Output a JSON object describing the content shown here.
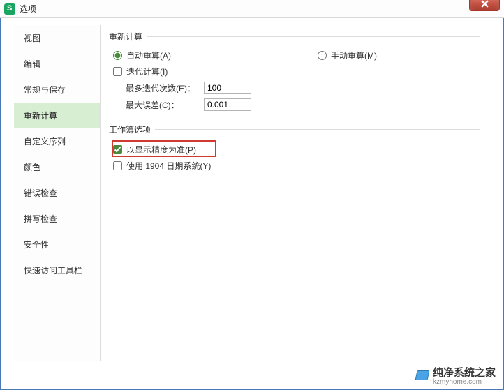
{
  "window": {
    "title": "选项"
  },
  "sidebar": {
    "items": [
      {
        "label": "视图"
      },
      {
        "label": "编辑"
      },
      {
        "label": "常规与保存"
      },
      {
        "label": "重新计算"
      },
      {
        "label": "自定义序列"
      },
      {
        "label": "颜色"
      },
      {
        "label": "错误检查"
      },
      {
        "label": "拼写检查"
      },
      {
        "label": "安全性"
      },
      {
        "label": "快速访问工具栏"
      }
    ],
    "active_index": 3
  },
  "groups": {
    "recalc": {
      "legend": "重新计算",
      "auto_label": "自动重算(A)",
      "manual_label": "手动重算(M)",
      "auto_checked": true,
      "iter_label": "迭代计算(I)",
      "iter_checked": false,
      "max_iter_label": "最多迭代次数(E)：",
      "max_iter_value": "100",
      "max_diff_label": "最大误差(C)：",
      "max_diff_value": "0.001"
    },
    "workbook": {
      "legend": "工作簿选项",
      "precision_label": "以显示精度为准(P)",
      "precision_checked": true,
      "date1904_label": "使用 1904 日期系统(Y)",
      "date1904_checked": false
    }
  },
  "watermark": {
    "main": "纯净系统之家",
    "sub": "kzmyhome.com"
  }
}
